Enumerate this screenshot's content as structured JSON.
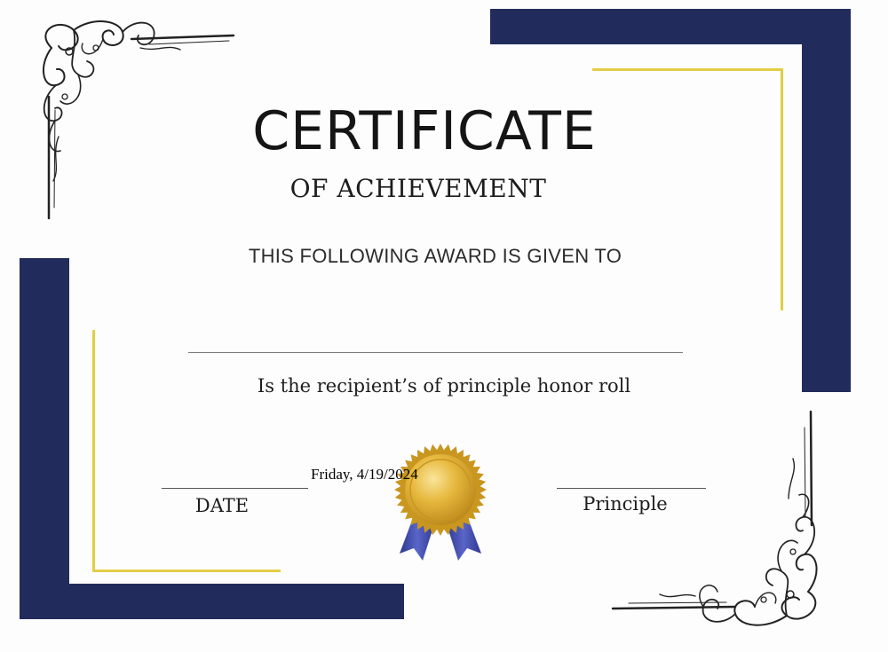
{
  "certificate": {
    "title": "CERTIFICATE",
    "subtitle": "OF ACHIEVEMENT",
    "given_text": "THIS FOLLOWING AWARD IS GIVEN TO",
    "recipient_text": "Is the recipient’s of principle honor roll",
    "date_label": "DATE",
    "date_value": "Friday, 4/19/2024",
    "principal_label": "Principle"
  },
  "colors": {
    "navy": "#222c5c",
    "gold": "#e3cd45",
    "seal_gold": "#d9a829",
    "ribbon": "#3a46a8"
  },
  "icons": {
    "corner_top_left": "ornate-flourish-icon",
    "corner_bottom_right": "ornate-flourish-icon",
    "seal": "award-seal-icon"
  }
}
